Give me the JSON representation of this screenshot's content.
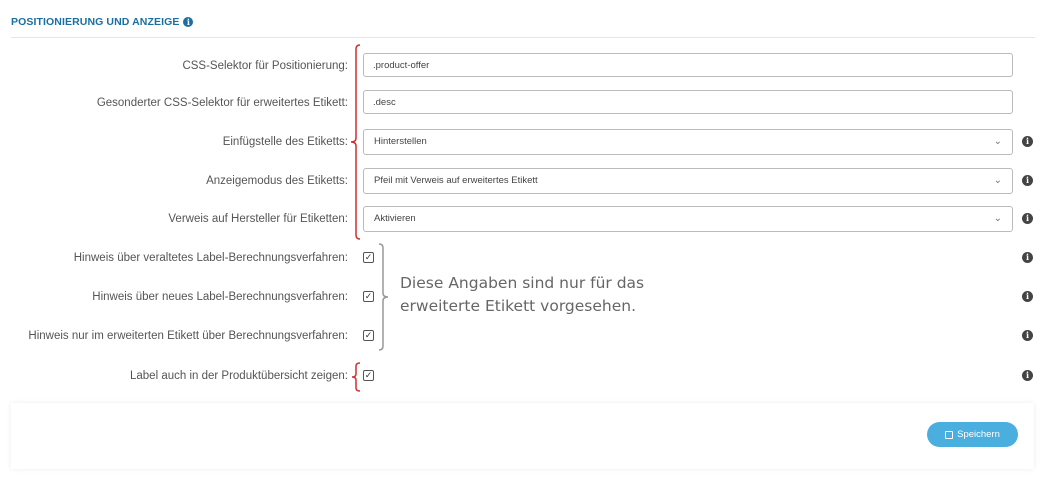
{
  "section": {
    "title": "POSITIONIERUNG UND ANZEIGE"
  },
  "fields": {
    "css_selector": {
      "label": "CSS-Selektor für Positionierung:",
      "value": ".product-offer"
    },
    "extended_selector": {
      "label": "Gesonderter CSS-Selektor für erweitertes Etikett:",
      "value": ".desc"
    },
    "insert_position": {
      "label": "Einfügstelle des Etiketts:",
      "value": "Hinterstellen"
    },
    "display_mode": {
      "label": "Anzeigemodus des Etiketts:",
      "value": "Pfeil mit Verweis auf erweitertes Etikett"
    },
    "manufacturer_reference": {
      "label": "Verweis auf Hersteller für Etiketten:",
      "value": "Aktivieren"
    }
  },
  "checkboxes": {
    "old_calc_notice": {
      "label": "Hinweis über veraltetes Label-Berechnungsverfahren:",
      "checked": true
    },
    "new_calc_notice": {
      "label": "Hinweis über neues Label-Berechnungsverfahren:",
      "checked": true
    },
    "extended_only_notice": {
      "label": "Hinweis nur im erweiterten Etikett über Berechnungsverfahren:",
      "checked": true
    },
    "show_in_overview": {
      "label": "Label auch in der Produktübersicht zeigen:",
      "checked": true
    }
  },
  "annotation": {
    "line1": "Diese Angaben sind nur für das",
    "line2": "erweiterte Etikett vorgesehen."
  },
  "footer": {
    "save_label": "Speichern"
  },
  "colors": {
    "accent": "#1a6fa0",
    "button": "#4aaede",
    "bracket_red": "#d32f2f",
    "bracket_gray": "#999999"
  }
}
